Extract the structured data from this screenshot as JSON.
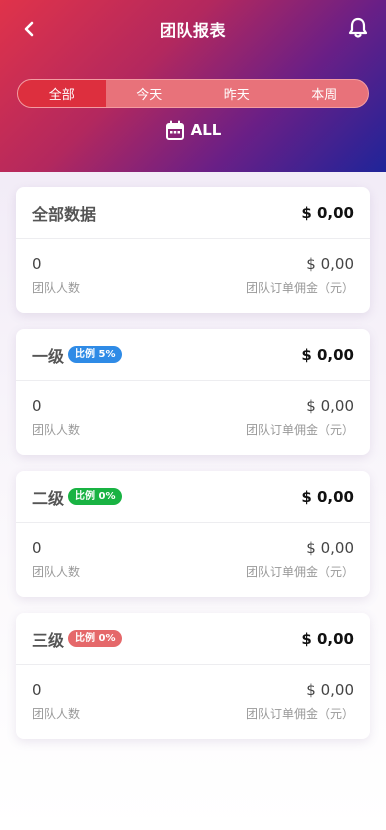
{
  "header": {
    "title": "团队报表",
    "back_icon": "chevron-left-icon",
    "bell_icon": "bell-icon",
    "gradient": [
      "#e0334a",
      "#b3285e",
      "#6a1f86",
      "#1f2499"
    ]
  },
  "tabs": [
    {
      "label": "全部",
      "active": true
    },
    {
      "label": "今天",
      "active": false
    },
    {
      "label": "昨天",
      "active": false
    },
    {
      "label": "本周",
      "active": false
    }
  ],
  "date_filter": {
    "icon": "calendar-icon",
    "label": "ALL"
  },
  "cards": [
    {
      "title": "全部数据",
      "badge": null,
      "badge_color": null,
      "amount": "$ 0,00",
      "count": "0",
      "count_label": "团队人数",
      "commission": "$ 0,00",
      "commission_label": "团队订单佣金（元）"
    },
    {
      "title": "一级",
      "badge": "比例 5%",
      "badge_color": "#2f8be6",
      "amount": "$ 0,00",
      "count": "0",
      "count_label": "团队人数",
      "commission": "$ 0,00",
      "commission_label": "团队订单佣金（元）"
    },
    {
      "title": "二级",
      "badge": "比例 0%",
      "badge_color": "#19b343",
      "amount": "$ 0,00",
      "count": "0",
      "count_label": "团队人数",
      "commission": "$ 0,00",
      "commission_label": "团队订单佣金（元）"
    },
    {
      "title": "三级",
      "badge": "比例 0%",
      "badge_color": "#e5686a",
      "amount": "$ 0,00",
      "count": "0",
      "count_label": "团队人数",
      "commission": "$ 0,00",
      "commission_label": "团队订单佣金（元）"
    }
  ]
}
